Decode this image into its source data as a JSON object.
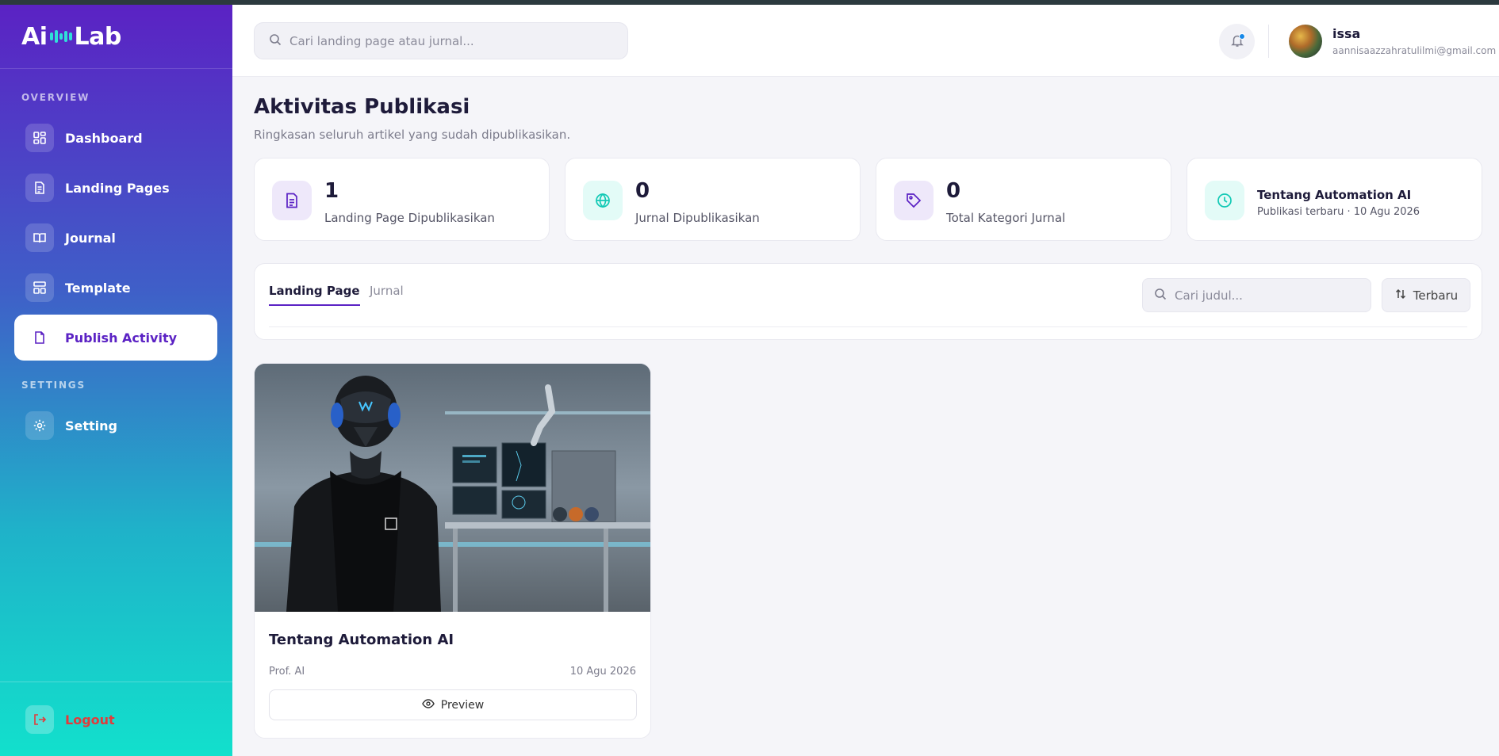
{
  "brand": {
    "logo_left": "Ai",
    "logo_right": "Lab"
  },
  "sidebar": {
    "overview_label": "OVERVIEW",
    "settings_label": "SETTINGS",
    "items": [
      {
        "label": "Dashboard",
        "icon": "grid-icon"
      },
      {
        "label": "Landing Pages",
        "icon": "document-icon"
      },
      {
        "label": "Journal",
        "icon": "book-icon"
      },
      {
        "label": "Template",
        "icon": "layout-icon"
      },
      {
        "label": "Publish Activity",
        "icon": "file-icon",
        "active": true
      }
    ],
    "setting_item": {
      "label": "Setting",
      "icon": "gear-icon"
    },
    "logout_label": "Logout"
  },
  "header": {
    "search_placeholder": "Cari landing page atau jurnal...",
    "user": {
      "name": "issa",
      "email": "aannisaazzahratulilmi@gmail.com"
    }
  },
  "page": {
    "title": "Aktivitas Publikasi",
    "subtitle": "Ringkasan seluruh artikel yang sudah dipublikasikan."
  },
  "stats": [
    {
      "value": "1",
      "label": "Landing Page Dipublikasikan",
      "icon": "document-icon"
    },
    {
      "value": "0",
      "label": "Jurnal Dipublikasikan",
      "icon": "globe-icon"
    },
    {
      "value": "0",
      "label": "Total Kategori Jurnal",
      "icon": "tag-icon"
    },
    {
      "title": "Tentang Automation AI",
      "sub": "Publikasi terbaru · 10 Agu 2026",
      "icon": "clock-icon"
    }
  ],
  "filters": {
    "tabs": [
      "Landing Page",
      "Jurnal"
    ],
    "active_tab": "Landing Page",
    "search_placeholder": "Cari judul...",
    "sort_label": "Terbaru"
  },
  "cards": [
    {
      "title": "Tentang Automation AI",
      "author": "Prof. AI",
      "date": "10 Agu 2026",
      "preview_label": "Preview"
    }
  ],
  "colors": {
    "accent": "#5b22c4",
    "teal": "#12e0cc",
    "danger": "#e23b3b"
  }
}
